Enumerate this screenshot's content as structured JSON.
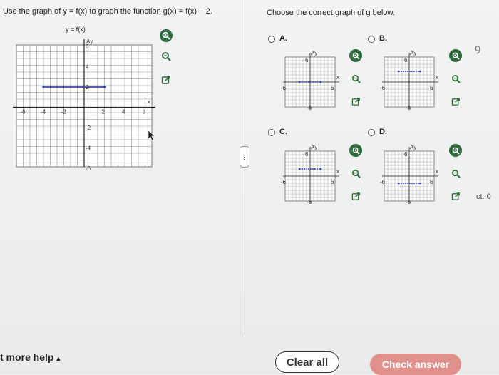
{
  "question": {
    "left_prompt": "Use the graph of y = f(x) to graph the function g(x) = f(x) − 2.",
    "right_prompt": "Choose the correct graph of g below.",
    "main_graph": {
      "title": "y = f(x)",
      "y_axis_label": "Ay",
      "x_axis_label": "x",
      "x_ticks": [
        "-6",
        "-4",
        "-2",
        "2",
        "4",
        "6"
      ],
      "y_ticks": [
        "6",
        "4",
        "2",
        "-2",
        "-4",
        "-6"
      ]
    },
    "segment_color": "#3b3fc4"
  },
  "options": [
    {
      "key": "A",
      "label": "A.",
      "y_label": "Ay",
      "top_tick": "6",
      "left_tick": "-6",
      "right_tick": "6",
      "bottom_tick": "-6",
      "x_label": "x"
    },
    {
      "key": "B",
      "label": "B.",
      "y_label": "Ay",
      "top_tick": "6",
      "left_tick": "-6",
      "right_tick": "6",
      "bottom_tick": "-6",
      "x_label": "x"
    },
    {
      "key": "C",
      "label": "C.",
      "y_label": "Ay",
      "top_tick": "6",
      "left_tick": "-6",
      "right_tick": "6",
      "bottom_tick": "-6",
      "x_label": "x"
    },
    {
      "key": "D",
      "label": "D.",
      "y_label": "Ay",
      "top_tick": "6",
      "left_tick": "-6",
      "right_tick": "6",
      "bottom_tick": "-6",
      "x_label": "x"
    }
  ],
  "icons": {
    "zoom_in": "zoom-in-icon",
    "zoom_out": "zoom-out-icon",
    "external": "external-link-icon"
  },
  "footer": {
    "more_help": "t more help",
    "more_help_arrow": "▴",
    "clear_all": "Clear all",
    "check_answer": "Check answer"
  },
  "side": {
    "count_text": "ct: 0",
    "partial_char": "ꝯ"
  },
  "colors": {
    "zoom_green": "#2f6a3e",
    "check_answer_bg": "#e0918c",
    "segment": "#3b3fc4"
  }
}
